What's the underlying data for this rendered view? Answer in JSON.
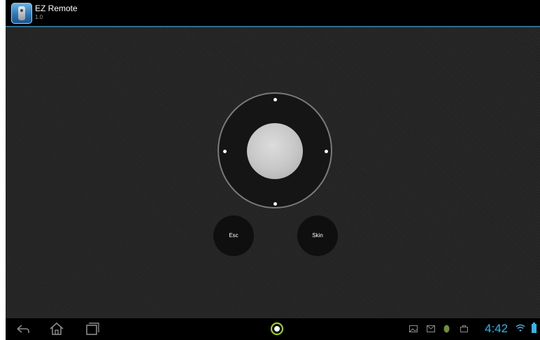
{
  "app": {
    "title": "EZ Remote",
    "version": "1.0"
  },
  "remote": {
    "esc_label": "Esc",
    "skin_label": "Skin"
  },
  "status": {
    "time": "4:42"
  },
  "icons": {
    "app": "remote-app-icon",
    "back": "back-icon",
    "home": "home-icon",
    "recents": "recent-apps-icon",
    "launcher": "launcher-icon",
    "notifications": [
      "gallery-icon",
      "gmail-icon",
      "android-icon",
      "briefcase-icon"
    ],
    "wifi": "wifi-icon",
    "battery": "battery-icon"
  },
  "colors": {
    "accent": "#35b5e5",
    "launcher": "#9ccc27"
  }
}
